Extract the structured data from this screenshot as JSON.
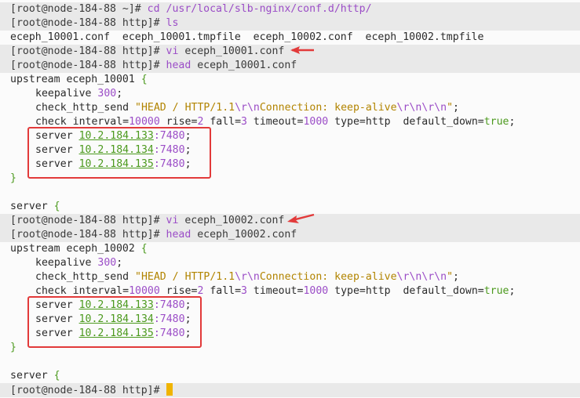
{
  "colors": {
    "background": "#fbfbfb",
    "prompt_band": "#e9e9e9",
    "command": "#9b4dc7",
    "number": "#9b4dc7",
    "string": "#b28400",
    "ip": "#4c9a1e",
    "bool": "#4c9a1e",
    "annotation": "#e23a3a",
    "cursor": "#f0b400"
  },
  "lines": {
    "l1": {
      "prompt": "[root@node-184-88 ~]# ",
      "cmd": "cd",
      "arg": " /usr/local/slb-nginx/conf.d/http/"
    },
    "l2": {
      "prompt": "[root@node-184-88 http]# ",
      "cmd": "ls"
    },
    "l3": {
      "text": "eceph_10001.conf  eceph_10001.tmpfile  eceph_10002.conf  eceph_10002.tmpfile"
    },
    "l4": {
      "prompt": "[root@node-184-88 http]# ",
      "cmd": "vi",
      "arg": " eceph_10001.conf"
    },
    "l5": {
      "prompt": "[root@node-184-88 http]# ",
      "cmd": "head",
      "arg": " eceph_10001.conf"
    },
    "l6": {
      "text": "upstream eceph_10001 ",
      "brace": "{"
    },
    "l7": {
      "kw": "keepalive ",
      "num": "300",
      "end": ";"
    },
    "l8": {
      "kw": "check_http_send ",
      "s1": "\"HEAD / HTTP/1.1",
      "e1": "\\r\\n",
      "s2": "Connection: keep-alive",
      "e2": "\\r\\n\\r\\n",
      "s3": "\"",
      "end": ";"
    },
    "l9": {
      "kw": "check interval=",
      "n1": "10000",
      "t2": " rise=",
      "n2": "2",
      "t3": " fall=",
      "n3": "3",
      "t4": " timeout=",
      "n4": "1000",
      "t5": " type=http  default_down=",
      "b": "true",
      "end": ";"
    },
    "l10": {
      "kw": "server ",
      "ip": "10.2.184.133",
      "port": ":7480",
      "end": ";"
    },
    "l11": {
      "kw": "server ",
      "ip": "10.2.184.134",
      "port": ":7480",
      "end": ";"
    },
    "l12": {
      "kw": "server ",
      "ip": "10.2.184.135",
      "port": ":7480",
      "end": ";"
    },
    "l13": {
      "brace": "}"
    },
    "l15": {
      "kw": "server ",
      "brace": "{"
    },
    "l16": {
      "prompt": "[root@node-184-88 http]# ",
      "cmd": "vi",
      "arg": " eceph_10002.conf"
    },
    "l17": {
      "prompt": "[root@node-184-88 http]# ",
      "cmd": "head",
      "arg": " eceph_10002.conf"
    },
    "l18": {
      "text": "upstream eceph_10002 ",
      "brace": "{"
    },
    "l19": {
      "kw": "keepalive ",
      "num": "300",
      "end": ";"
    },
    "l20": {
      "kw": "check_http_send ",
      "s1": "\"HEAD / HTTP/1.1",
      "e1": "\\r\\n",
      "s2": "Connection: keep-alive",
      "e2": "\\r\\n\\r\\n",
      "s3": "\"",
      "end": ";"
    },
    "l21": {
      "kw": "check interval=",
      "n1": "10000",
      "t2": " rise=",
      "n2": "2",
      "t3": " fall=",
      "n3": "3",
      "t4": " timeout=",
      "n4": "1000",
      "t5": " type=http  default_down=",
      "b": "true",
      "end": ";"
    },
    "l22": {
      "kw": "server ",
      "ip": "10.2.184.133",
      "port": ":7480",
      "end": ";"
    },
    "l23": {
      "kw": "server ",
      "ip": "10.2.184.134",
      "port": ":7480",
      "end": ";"
    },
    "l24": {
      "kw": "server ",
      "ip": "10.2.184.135",
      "port": ":7480",
      "end": ";"
    },
    "l25": {
      "brace": "}"
    },
    "l27": {
      "kw": "server ",
      "brace": "{"
    },
    "l28": {
      "prompt": "[root@node-184-88 http]# "
    }
  }
}
